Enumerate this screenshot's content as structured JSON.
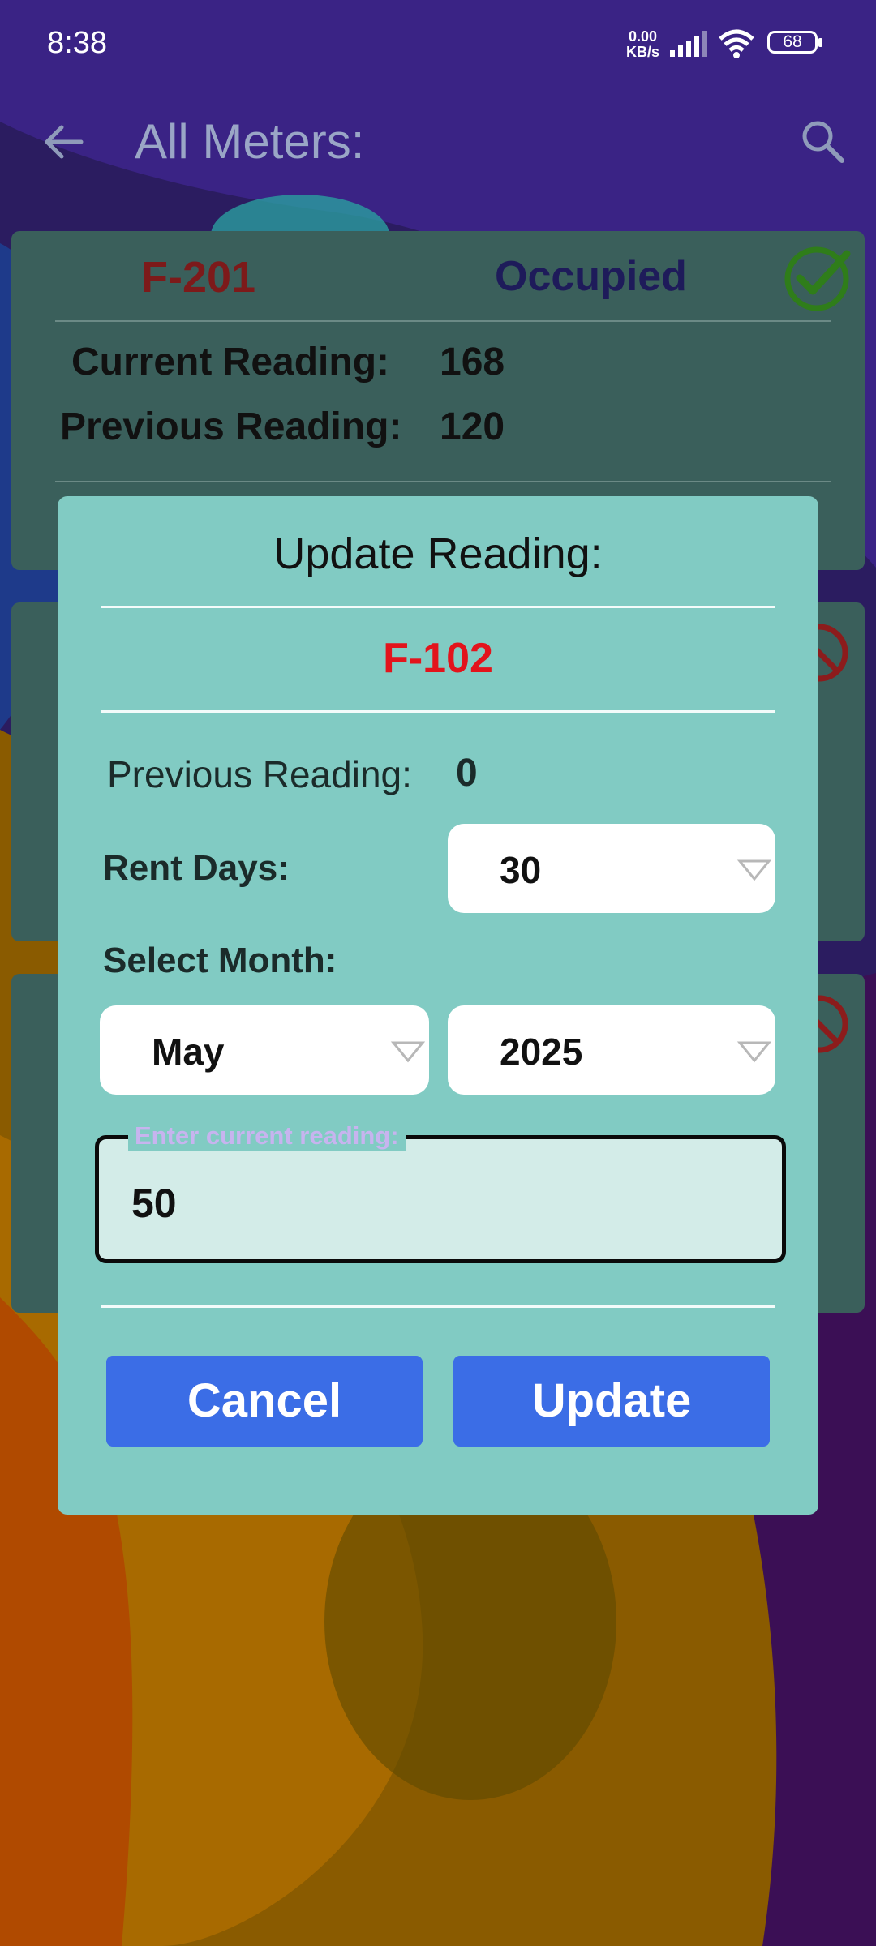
{
  "status_bar": {
    "time": "8:38",
    "net_speed_value": "0.00",
    "net_speed_unit": "KB/s",
    "battery": "68"
  },
  "app_bar": {
    "title": "All Meters:",
    "back_icon": "arrow-left-icon",
    "search_icon": "search-icon"
  },
  "cards": [
    {
      "meter": "F-201",
      "status": "Occupied",
      "current_label": "Current Reading:",
      "current_value": "168",
      "previous_label": "Previous Reading:",
      "previous_value": "120",
      "status_icon": "check-circle-icon"
    },
    {
      "status_icon": "cancel-circle-icon"
    },
    {
      "status_icon": "cancel-circle-icon"
    }
  ],
  "dialog": {
    "title": "Update Reading:",
    "meter": "F-102",
    "previous_label": "Previous Reading:",
    "previous_value": "0",
    "rent_days_label": "Rent Days:",
    "rent_days_value": "30",
    "select_month_label": "Select Month:",
    "month_value": "May",
    "year_value": "2025",
    "reading_label": "Enter current reading:",
    "reading_value": "50",
    "cancel_label": "Cancel",
    "update_label": "Update"
  },
  "colors": {
    "dialog_bg": "#81cbc3",
    "button_bg": "#3b6de6",
    "meter_red": "#e3141c"
  }
}
